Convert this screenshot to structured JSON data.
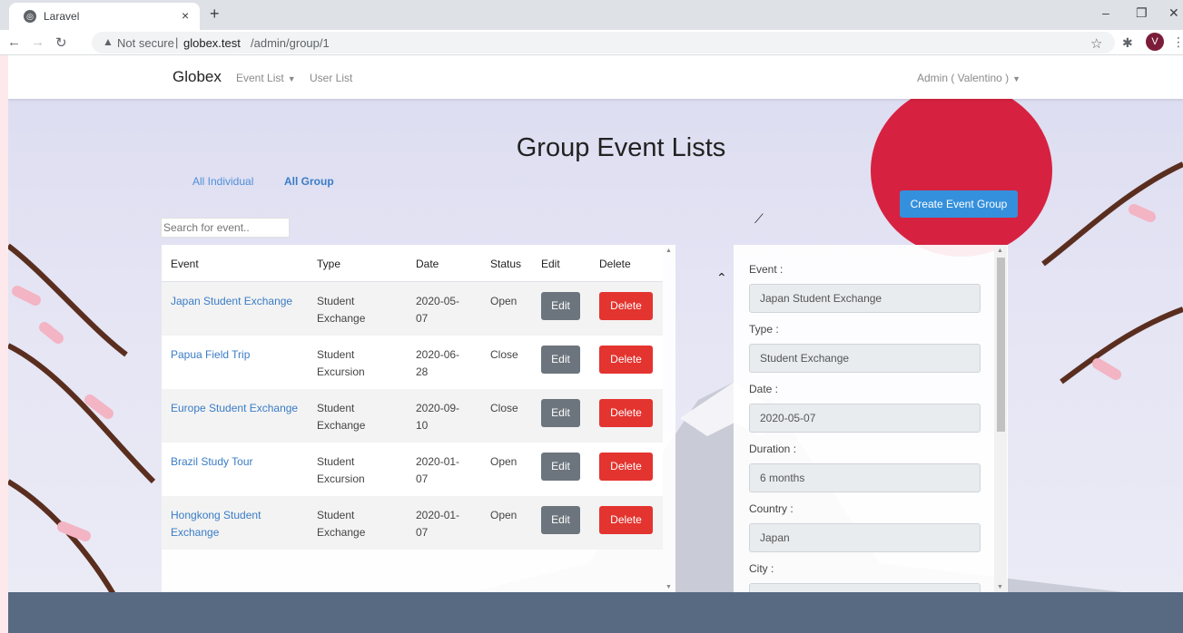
{
  "browser": {
    "tab_title": "Laravel",
    "tab_close": "×",
    "new_tab": "+",
    "not_secure": "Not secure",
    "separator": "|",
    "url_host": "globex.test",
    "url_path": "/admin/group/1",
    "profile_initial": "V",
    "win_min": "–",
    "win_max": "❐",
    "win_close": "✕"
  },
  "navbar": {
    "brand": "Globex",
    "event_list": "Event List",
    "user_list": "User List",
    "account": "Admin ( Valentino )"
  },
  "page": {
    "title": "Group Event Lists",
    "tabs": [
      "All Individual",
      "All Group"
    ],
    "create_button": "Create Event Group",
    "search_placeholder": "Search for event.."
  },
  "table": {
    "headers": [
      "Event",
      "Type",
      "Date",
      "Status",
      "Edit",
      "Delete"
    ],
    "edit_label": "Edit",
    "delete_label": "Delete",
    "rows": [
      {
        "event": "Japan Student Exchange",
        "type": "Student Exchange",
        "date": "2020-05-07",
        "status": "Open"
      },
      {
        "event": "Papua Field Trip",
        "type": "Student Excursion",
        "date": "2020-06-28",
        "status": "Close"
      },
      {
        "event": "Europe Student Exchange",
        "type": "Student Exchange",
        "date": "2020-09-10",
        "status": "Close"
      },
      {
        "event": "Brazil Study Tour",
        "type": "Student Excursion",
        "date": "2020-01-07",
        "status": "Open"
      },
      {
        "event": "Hongkong Student Exchange",
        "type": "Student Exchange",
        "date": "2020-01-07",
        "status": "Open"
      }
    ]
  },
  "form": {
    "fields": [
      {
        "label": "Event :",
        "value": "Japan Student Exchange"
      },
      {
        "label": "Type :",
        "value": "Student Exchange"
      },
      {
        "label": "Date :",
        "value": "2020-05-07"
      },
      {
        "label": "Duration :",
        "value": "6 months"
      },
      {
        "label": "Country :",
        "value": "Japan"
      },
      {
        "label": "City :",
        "value": ""
      }
    ]
  },
  "colors": {
    "primary": "#3490dc",
    "danger": "#e3342f",
    "secondary": "#6c757d",
    "link": "#3a7cc6",
    "sun": "#d62240"
  }
}
